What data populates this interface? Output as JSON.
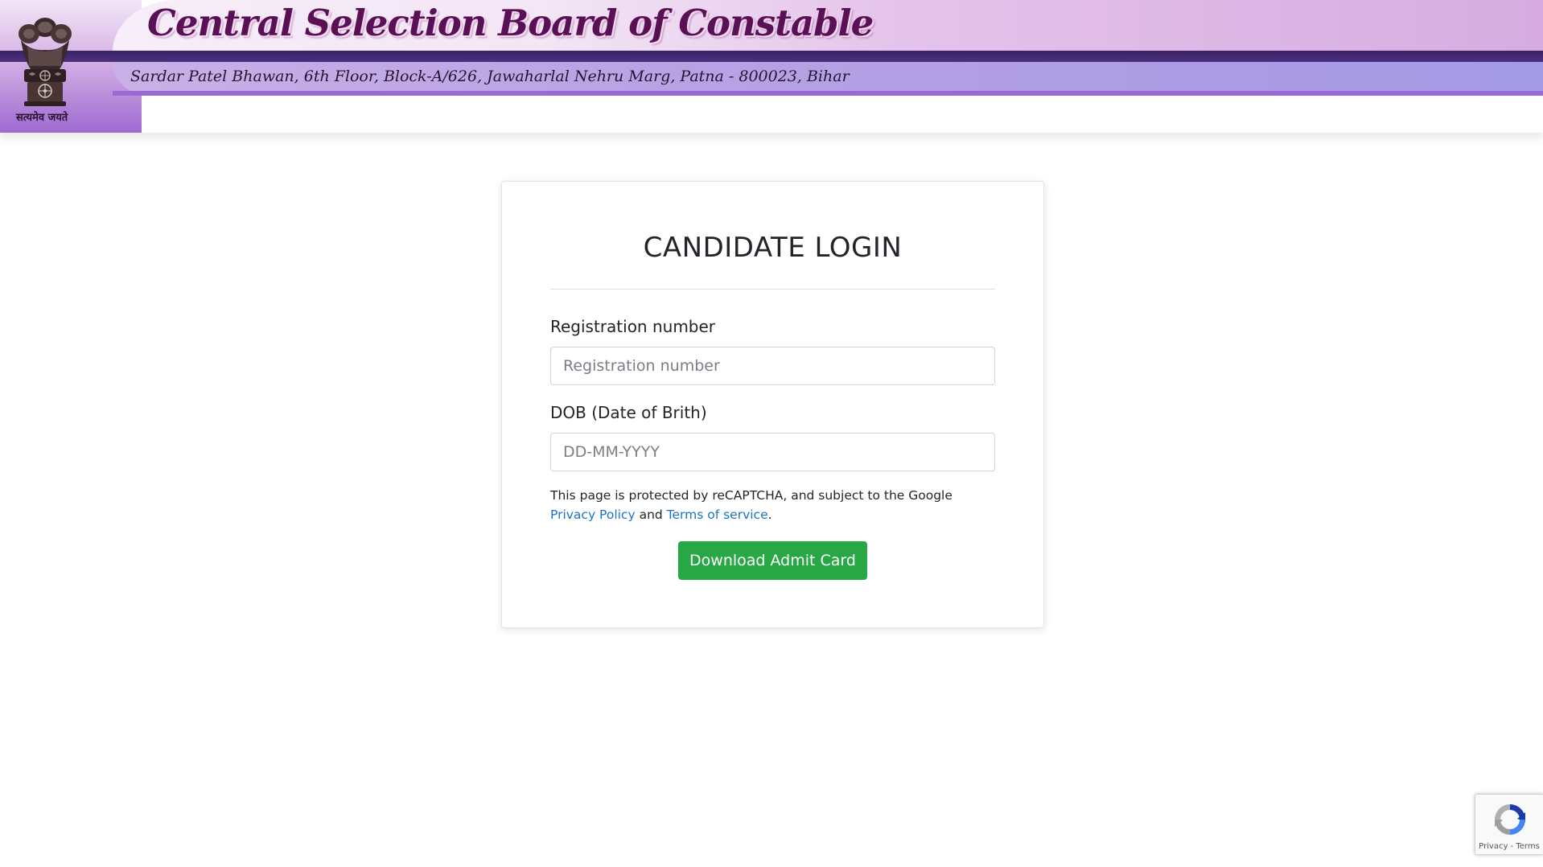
{
  "header": {
    "title": "Central Selection Board of Constable",
    "address": "Sardar Patel Bhawan, 6th Floor, Block-A/626, Jawaharlal Nehru Marg, Patna - 800023, Bihar",
    "emblem_motto": "सत्यमेव जयते"
  },
  "login": {
    "title": "CANDIDATE LOGIN",
    "registration_label": "Registration number",
    "registration_value": "",
    "registration_placeholder": "Registration number",
    "dob_label": "DOB (Date of Brith)",
    "dob_value": "",
    "dob_placeholder": "DD-MM-YYYY",
    "recaptcha_text_1": "This page is protected by reCAPTCHA, and subject to the Google ",
    "privacy_link": "Privacy Policy",
    "recaptcha_text_2": " and ",
    "terms_link": "Terms of service",
    "recaptcha_text_3": ".",
    "download_button": "Download Admit Card"
  },
  "recaptcha_badge": {
    "privacy": "Privacy",
    "separator": " - ",
    "terms": "Terms"
  },
  "colors": {
    "title_purple": "#5a1055",
    "header_dark_stripe": "#3a2466",
    "button_green": "#28a745",
    "link_blue": "#1a73c8"
  },
  "icons": {
    "emblem": "ashoka-emblem-icon",
    "recaptcha": "recaptcha-logo-icon"
  }
}
